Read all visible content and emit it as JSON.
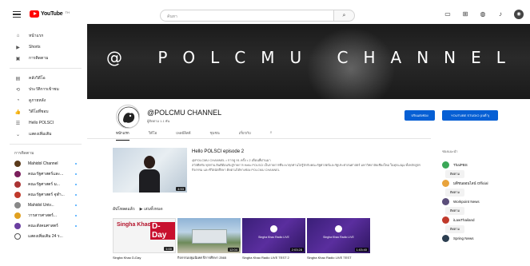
{
  "topbar": {
    "logo_text": "YouTube",
    "logo_sup": "TH",
    "search_placeholder": "ค้นหา",
    "search_icon_glyph": "⌕",
    "icons": [
      "video-create-icon",
      "apps-grid-icon",
      "chat-icon",
      "bell-icon"
    ],
    "avatar_glyph": "◉"
  },
  "sidebar": {
    "items": [
      {
        "label": "หน้าแรก",
        "icon": "⌂"
      },
      {
        "label": "Shorts",
        "icon": "▶"
      },
      {
        "label": "การติดตาม",
        "icon": "▣"
      }
    ],
    "items2": [
      {
        "label": "คลังวิดีโอ",
        "icon": "▤"
      },
      {
        "label": "ประวัติการเข้าชม",
        "icon": "⟲"
      },
      {
        "label": "ดูภายหลัง",
        "icon": "◔"
      },
      {
        "label": "วิดีโอที่ชอบ",
        "icon": "👍"
      },
      {
        "label": "Hello POLSCI",
        "icon": "☰"
      },
      {
        "label": "แสดงเพิ่มเติม",
        "icon": "⌄"
      }
    ],
    "subs_heading": "การติดตาม",
    "subs": [
      {
        "label": "Mahidol Channel",
        "color": "#5a3a1a"
      },
      {
        "label": "คณะรัฐศาสตร์และ...",
        "color": "#7a1f5c"
      },
      {
        "label": "คณะรัฐศาสตร์ ม...",
        "color": "#a33"
      },
      {
        "label": "คณะรัฐศาสตร์ จุฬา...",
        "color": "#c0392b"
      },
      {
        "label": "Mahidol Univ...",
        "color": "#888"
      },
      {
        "label": "วารสารศาสตร์...",
        "color": "#e0a020"
      },
      {
        "label": "คณะสังคมศาสตร์",
        "color": "#6a3fa0"
      },
      {
        "label": "แสดงเพิ่มเติม 24 ร...",
        "color": "#ffffff"
      }
    ]
  },
  "banner": {
    "text": "@ POLCMU CHANNEL"
  },
  "channel": {
    "name": "@POLCMU CHANNEL",
    "meta": "ผู้ติดตาม 1.1 พัน",
    "customize_label": "ปรับแต่งช่อง",
    "studio_label": "YOUTUBE STUDIO (เบต้า)"
  },
  "tabs": [
    {
      "label": "หน้าแรก",
      "active": true
    },
    {
      "label": "วิดีโอ",
      "active": false
    },
    {
      "label": "เพลย์ลิสต์",
      "active": false
    },
    {
      "label": "ชุมชน",
      "active": false
    },
    {
      "label": "เกี่ยวกับ",
      "active": false
    }
  ],
  "tab_search_glyph": "⌕",
  "featured": {
    "title": "Hello POLSCI episode 2",
    "meta": "@POLCMU CHANNEL • การดู 91 ครั้ง • 2 เดือนที่ผ่านมา",
    "desc": "สวัสดีครับ ทุกท่าน ยินดีต้อนรับสู่รายการ Hello POLSCI เป็นรายการที่จะพาทุกท่านไปรู้จักกับคณะรัฐศาสตร์และรัฐประศาสนศาสตร์ มหาวิทยาลัยเชียงใหม่ ในทุกแง่มุม ทั้งหลักสูตร กิจกรรม และชีวิตนักศึกษา ติดตามได้ทางช่อง POLCMU CHANNEL",
    "duration": "4:53"
  },
  "shelf": {
    "title": "อัปโหลดแล้ว",
    "play_label": "เล่นทั้งหมด",
    "videos": [
      {
        "title": "Singha Khao D-Day",
        "duration": "1:00",
        "style": "white",
        "thumb_text": "Singha Khao",
        "thumb_sub": "D-Day"
      },
      {
        "title": "กิจกรรมปฐมนิเทศ ปีการศึกษา 2565",
        "duration": "12:04",
        "style": "photo",
        "thumb_text": "",
        "thumb_sub": ""
      },
      {
        "title": "Singha Khao Radio LIVE TEST 2",
        "duration": "2:03:28",
        "style": "purple",
        "thumb_text": "Singha Khao Radio LIVE",
        "thumb_sub": ""
      },
      {
        "title": "Singha Khao Radio LIVE TEST",
        "duration": "1:03:40",
        "style": "purple",
        "thumb_text": "Singha Khao Radio LIVE",
        "thumb_sub": ""
      }
    ]
  },
  "right_col": {
    "heading": "ช่องแนะนำ",
    "button_label": "ติดตาม",
    "channels": [
      {
        "name": "ThaiPBS",
        "color": "#3aa757"
      },
      {
        "name": "มติชนออนไลน์ Official",
        "color": "#e8a33c"
      },
      {
        "name": "Workpoint News",
        "color": "#5b4e7a"
      },
      {
        "name": "iLawThailand",
        "color": "#c0392b"
      },
      {
        "name": "Spring News",
        "color": "#2c3e50"
      }
    ]
  }
}
